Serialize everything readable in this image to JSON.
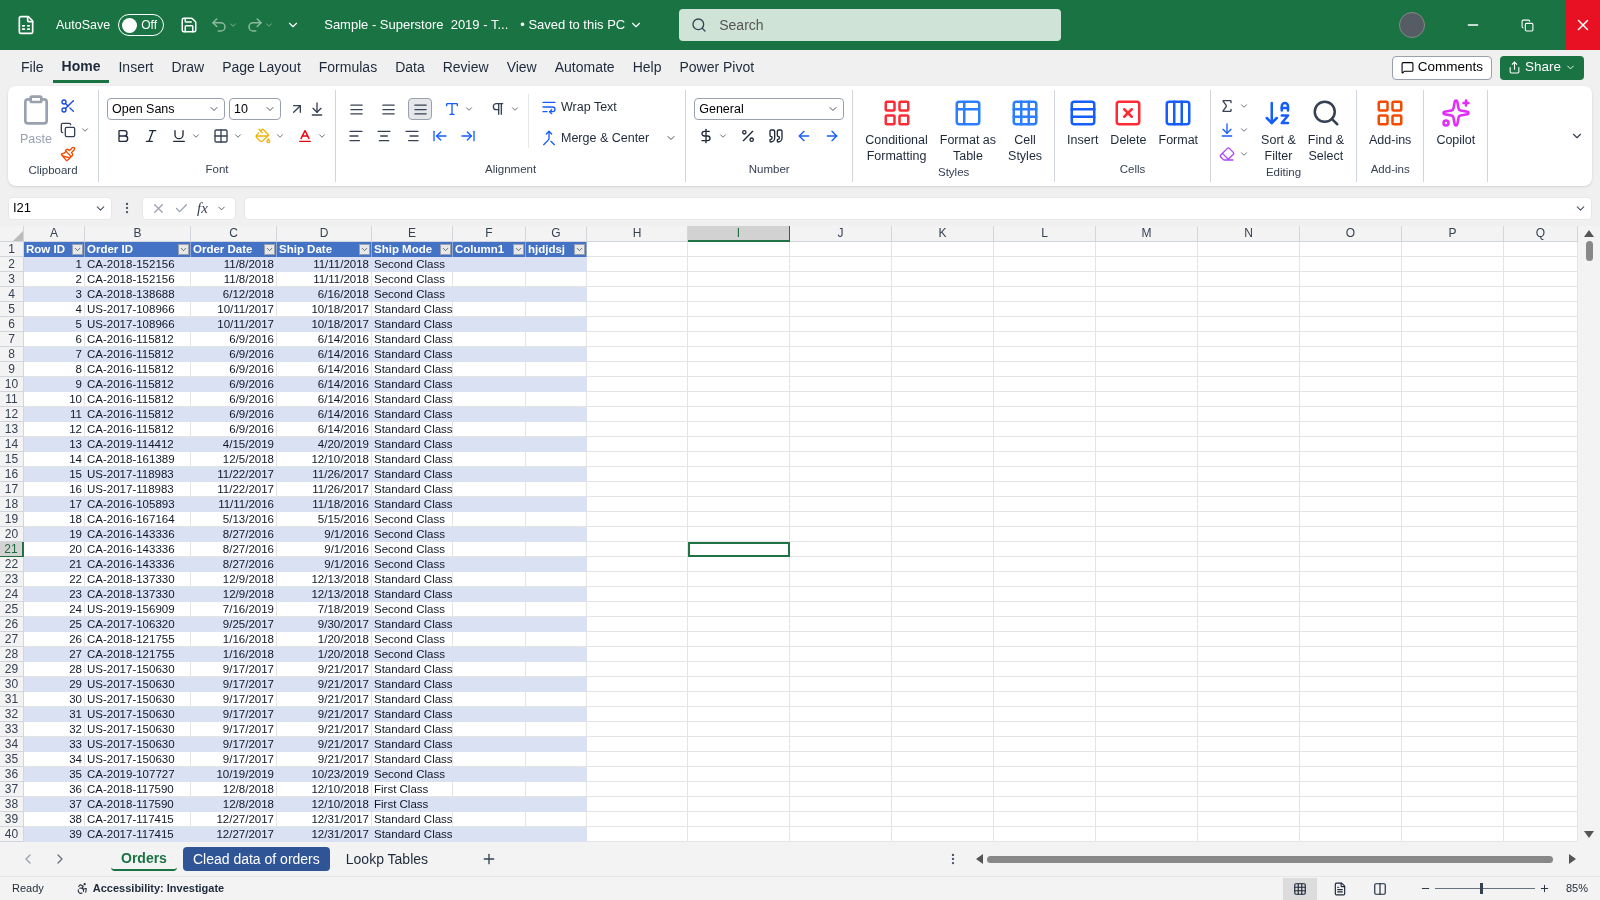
{
  "title_bar": {
    "autosave_label": "AutoSave",
    "autosave": {
      "on": false,
      "label": "Off"
    },
    "undo": {
      "disabled": true
    },
    "redo": {
      "disabled": true
    },
    "document_title": "Sample - Superstore  2019 - T...",
    "save_status": "• Saved to this PC",
    "search": {
      "placeholder": "Search"
    }
  },
  "menu_tabs": [
    {
      "label": "File",
      "selected": false
    },
    {
      "label": "Home",
      "selected": true
    },
    {
      "label": "Insert",
      "selected": false
    },
    {
      "label": "Draw",
      "selected": false
    },
    {
      "label": "Page Layout",
      "selected": false
    },
    {
      "label": "Formulas",
      "selected": false
    },
    {
      "label": "Data",
      "selected": false
    },
    {
      "label": "Review",
      "selected": false
    },
    {
      "label": "View",
      "selected": false
    },
    {
      "label": "Automate",
      "selected": false
    },
    {
      "label": "Help",
      "selected": false
    },
    {
      "label": "Power Pivot",
      "selected": false
    }
  ],
  "actions": {
    "comments": "Comments",
    "share": "Share"
  },
  "ribbon": {
    "groups": [
      {
        "kind": "clipboard",
        "label": "Clipboard",
        "paste": {
          "label": "Paste",
          "disabled": true
        }
      },
      {
        "kind": "font",
        "label": "Font",
        "font_name": "Open Sans",
        "font_size": "10"
      },
      {
        "kind": "alignment",
        "label": "Alignment",
        "vertical_align": [
          {
            "selected": false
          },
          {
            "selected": false
          },
          {
            "selected": true
          }
        ],
        "wrap_text": "Wrap Text",
        "merge": "Merge & Center"
      },
      {
        "kind": "number",
        "label": "Number",
        "format": "General"
      },
      {
        "kind": "styles",
        "label": "Styles",
        "buttons": [
          {
            "lines": [
              "Conditional",
              "Formatting"
            ]
          },
          {
            "lines": [
              "Format as",
              "Table"
            ]
          },
          {
            "lines": [
              "Cell",
              "Styles"
            ]
          }
        ]
      },
      {
        "kind": "cells",
        "label": "Cells",
        "buttons": [
          {
            "lines": [
              "Insert"
            ]
          },
          {
            "lines": [
              "Delete"
            ]
          },
          {
            "lines": [
              "Format"
            ]
          }
        ]
      },
      {
        "kind": "editing",
        "label": "Editing",
        "buttons": [
          {
            "lines": [
              "Sort &",
              "Filter"
            ]
          },
          {
            "lines": [
              "Find &",
              "Select"
            ]
          }
        ]
      },
      {
        "kind": "addins",
        "label": "Add-ins",
        "buttons": [
          {
            "lines": [
              "Add-ins"
            ]
          }
        ]
      },
      {
        "kind": "copilot",
        "buttons": [
          {
            "lines": [
              "Copilot"
            ]
          }
        ]
      }
    ]
  },
  "formula_bar": {
    "name_box": "I21",
    "function_label": "fx"
  },
  "sheet": {
    "columns": [
      {
        "letter": "A",
        "selected": false
      },
      {
        "letter": "B",
        "selected": false
      },
      {
        "letter": "C",
        "selected": false
      },
      {
        "letter": "D",
        "selected": false
      },
      {
        "letter": "E",
        "selected": false
      },
      {
        "letter": "F",
        "selected": false
      },
      {
        "letter": "G",
        "selected": false
      },
      {
        "letter": "H",
        "selected": false
      },
      {
        "letter": "I",
        "selected": true
      },
      {
        "letter": "J",
        "selected": false
      },
      {
        "letter": "K",
        "selected": false
      },
      {
        "letter": "L",
        "selected": false
      },
      {
        "letter": "M",
        "selected": false
      },
      {
        "letter": "N",
        "selected": false
      },
      {
        "letter": "O",
        "selected": false
      },
      {
        "letter": "P",
        "selected": false
      },
      {
        "letter": "Q",
        "selected": false
      }
    ],
    "row_numbers": [
      {
        "label": "1",
        "selected": false
      },
      {
        "label": "2",
        "selected": false
      },
      {
        "label": "3",
        "selected": false
      },
      {
        "label": "4",
        "selected": false
      },
      {
        "label": "5",
        "selected": false
      },
      {
        "label": "6",
        "selected": false
      },
      {
        "label": "7",
        "selected": false
      },
      {
        "label": "8",
        "selected": false
      },
      {
        "label": "9",
        "selected": false
      },
      {
        "label": "10",
        "selected": false
      },
      {
        "label": "11",
        "selected": false
      },
      {
        "label": "12",
        "selected": false
      },
      {
        "label": "13",
        "selected": false
      },
      {
        "label": "14",
        "selected": false
      },
      {
        "label": "15",
        "selected": false
      },
      {
        "label": "16",
        "selected": false
      },
      {
        "label": "17",
        "selected": false
      },
      {
        "label": "18",
        "selected": false
      },
      {
        "label": "19",
        "selected": false
      },
      {
        "label": "20",
        "selected": false
      },
      {
        "label": "21",
        "selected": true
      },
      {
        "label": "22",
        "selected": false
      },
      {
        "label": "23",
        "selected": false
      },
      {
        "label": "24",
        "selected": false
      },
      {
        "label": "25",
        "selected": false
      },
      {
        "label": "26",
        "selected": false
      },
      {
        "label": "27",
        "selected": false
      },
      {
        "label": "28",
        "selected": false
      },
      {
        "label": "29",
        "selected": false
      },
      {
        "label": "30",
        "selected": false
      },
      {
        "label": "31",
        "selected": false
      },
      {
        "label": "32",
        "selected": false
      },
      {
        "label": "33",
        "selected": false
      },
      {
        "label": "34",
        "selected": false
      },
      {
        "label": "35",
        "selected": false
      },
      {
        "label": "36",
        "selected": false
      },
      {
        "label": "37",
        "selected": false
      },
      {
        "label": "38",
        "selected": false
      },
      {
        "label": "39",
        "selected": false
      },
      {
        "label": "40",
        "selected": false
      }
    ],
    "table": {
      "headers": [
        "Row ID",
        "Order ID",
        "Order Date",
        "Ship Date",
        "Ship Mode",
        "Column1",
        "hjdjdsj"
      ],
      "rows": [
        {
          "cells": [
            "1",
            "CA-2018-152156",
            "11/8/2018",
            "11/11/2018",
            "Second Class"
          ]
        },
        {
          "cells": [
            "2",
            "CA-2018-152156",
            "11/8/2018",
            "11/11/2018",
            "Second Class"
          ]
        },
        {
          "cells": [
            "3",
            "CA-2018-138688",
            "6/12/2018",
            "6/16/2018",
            "Second Class"
          ]
        },
        {
          "cells": [
            "4",
            "US-2017-108966",
            "10/11/2017",
            "10/18/2017",
            "Standard Class"
          ]
        },
        {
          "cells": [
            "5",
            "US-2017-108966",
            "10/11/2017",
            "10/18/2017",
            "Standard Class"
          ]
        },
        {
          "cells": [
            "6",
            "CA-2016-115812",
            "6/9/2016",
            "6/14/2016",
            "Standard Class"
          ]
        },
        {
          "cells": [
            "7",
            "CA-2016-115812",
            "6/9/2016",
            "6/14/2016",
            "Standard Class"
          ]
        },
        {
          "cells": [
            "8",
            "CA-2016-115812",
            "6/9/2016",
            "6/14/2016",
            "Standard Class"
          ]
        },
        {
          "cells": [
            "9",
            "CA-2016-115812",
            "6/9/2016",
            "6/14/2016",
            "Standard Class"
          ]
        },
        {
          "cells": [
            "10",
            "CA-2016-115812",
            "6/9/2016",
            "6/14/2016",
            "Standard Class"
          ]
        },
        {
          "cells": [
            "11",
            "CA-2016-115812",
            "6/9/2016",
            "6/14/2016",
            "Standard Class"
          ]
        },
        {
          "cells": [
            "12",
            "CA-2016-115812",
            "6/9/2016",
            "6/14/2016",
            "Standard Class"
          ]
        },
        {
          "cells": [
            "13",
            "CA-2019-114412",
            "4/15/2019",
            "4/20/2019",
            "Standard Class"
          ]
        },
        {
          "cells": [
            "14",
            "CA-2018-161389",
            "12/5/2018",
            "12/10/2018",
            "Standard Class"
          ]
        },
        {
          "cells": [
            "15",
            "US-2017-118983",
            "11/22/2017",
            "11/26/2017",
            "Standard Class"
          ]
        },
        {
          "cells": [
            "16",
            "US-2017-118983",
            "11/22/2017",
            "11/26/2017",
            "Standard Class"
          ]
        },
        {
          "cells": [
            "17",
            "CA-2016-105893",
            "11/11/2016",
            "11/18/2016",
            "Standard Class"
          ]
        },
        {
          "cells": [
            "18",
            "CA-2016-167164",
            "5/13/2016",
            "5/15/2016",
            "Second Class"
          ]
        },
        {
          "cells": [
            "19",
            "CA-2016-143336",
            "8/27/2016",
            "9/1/2016",
            "Second Class"
          ]
        },
        {
          "cells": [
            "20",
            "CA-2016-143336",
            "8/27/2016",
            "9/1/2016",
            "Second Class"
          ]
        },
        {
          "cells": [
            "21",
            "CA-2016-143336",
            "8/27/2016",
            "9/1/2016",
            "Second Class"
          ]
        },
        {
          "cells": [
            "22",
            "CA-2018-137330",
            "12/9/2018",
            "12/13/2018",
            "Standard Class"
          ]
        },
        {
          "cells": [
            "23",
            "CA-2018-137330",
            "12/9/2018",
            "12/13/2018",
            "Standard Class"
          ]
        },
        {
          "cells": [
            "24",
            "US-2019-156909",
            "7/16/2019",
            "7/18/2019",
            "Second Class"
          ]
        },
        {
          "cells": [
            "25",
            "CA-2017-106320",
            "9/25/2017",
            "9/30/2017",
            "Standard Class"
          ]
        },
        {
          "cells": [
            "26",
            "CA-2018-121755",
            "1/16/2018",
            "1/20/2018",
            "Second Class"
          ]
        },
        {
          "cells": [
            "27",
            "CA-2018-121755",
            "1/16/2018",
            "1/20/2018",
            "Second Class"
          ]
        },
        {
          "cells": [
            "28",
            "US-2017-150630",
            "9/17/2017",
            "9/21/2017",
            "Standard Class"
          ]
        },
        {
          "cells": [
            "29",
            "US-2017-150630",
            "9/17/2017",
            "9/21/2017",
            "Standard Class"
          ]
        },
        {
          "cells": [
            "30",
            "US-2017-150630",
            "9/17/2017",
            "9/21/2017",
            "Standard Class"
          ]
        },
        {
          "cells": [
            "31",
            "US-2017-150630",
            "9/17/2017",
            "9/21/2017",
            "Standard Class"
          ]
        },
        {
          "cells": [
            "32",
            "US-2017-150630",
            "9/17/2017",
            "9/21/2017",
            "Standard Class"
          ]
        },
        {
          "cells": [
            "33",
            "US-2017-150630",
            "9/17/2017",
            "9/21/2017",
            "Standard Class"
          ]
        },
        {
          "cells": [
            "34",
            "US-2017-150630",
            "9/17/2017",
            "9/21/2017",
            "Standard Class"
          ]
        },
        {
          "cells": [
            "35",
            "CA-2019-107727",
            "10/19/2019",
            "10/23/2019",
            "Second Class"
          ]
        },
        {
          "cells": [
            "36",
            "CA-2018-117590",
            "12/8/2018",
            "12/10/2018",
            "First Class"
          ]
        },
        {
          "cells": [
            "37",
            "CA-2018-117590",
            "12/8/2018",
            "12/10/2018",
            "First Class"
          ]
        },
        {
          "cells": [
            "38",
            "CA-2017-117415",
            "12/27/2017",
            "12/31/2017",
            "Standard Class"
          ]
        },
        {
          "cells": [
            "39",
            "CA-2017-117415",
            "12/27/2017",
            "12/31/2017",
            "Standard Class"
          ]
        }
      ]
    }
  },
  "sheet_tabs": [
    {
      "label": "Orders",
      "selected": true
    },
    {
      "label": "Clead data of orders",
      "selected": false,
      "color": "#2f5597"
    },
    {
      "label": "Lookp Tables",
      "selected": false
    }
  ],
  "status_bar": {
    "ready": "Ready",
    "accessibility": "Accessibility: Investigate",
    "views": [
      {
        "selected": true
      },
      {
        "selected": false
      },
      {
        "selected": false
      }
    ],
    "zoom": {
      "level": 0.45,
      "reading": "85%"
    }
  }
}
